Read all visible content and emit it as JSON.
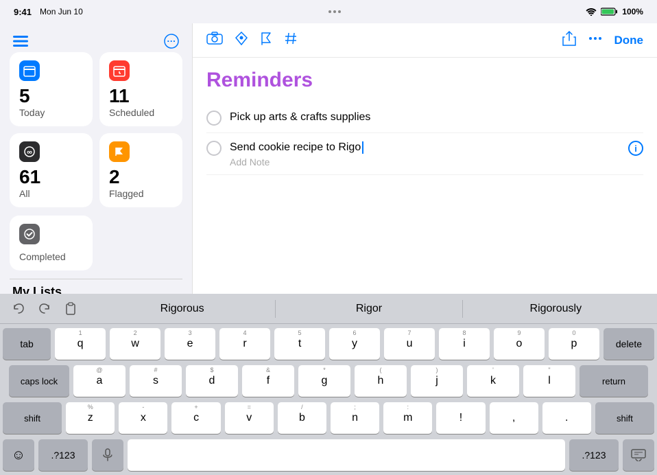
{
  "statusBar": {
    "time": "9:41",
    "date": "Mon Jun 10",
    "wifi": "WiFi",
    "battery": "100%"
  },
  "sidebar": {
    "smartLists": [
      {
        "id": "today",
        "label": "Today",
        "count": "5",
        "iconBg": "#007AFF",
        "iconSymbol": "📅"
      },
      {
        "id": "scheduled",
        "label": "Scheduled",
        "count": "11",
        "iconBg": "#FF3B30",
        "iconSymbol": "📅"
      },
      {
        "id": "all",
        "label": "All",
        "count": "61",
        "iconBg": "#2C2C2E",
        "iconSymbol": "∞"
      },
      {
        "id": "flagged",
        "label": "Flagged",
        "count": "2",
        "iconBg": "#FF9500",
        "iconSymbol": "⚑"
      }
    ],
    "completedLabel": "Completed",
    "myListsLabel": "My Lists"
  },
  "toolbar": {
    "doneLabel": "Done",
    "moreLabel": "...",
    "shareLabel": "Share"
  },
  "reminders": {
    "title": "Reminders",
    "items": [
      {
        "id": 1,
        "text": "Pick up arts & crafts supplies",
        "note": null
      },
      {
        "id": 2,
        "text": "Send cookie recipe to Rigo",
        "note": "Add Note",
        "active": true
      }
    ]
  },
  "autocomplete": {
    "actions": [
      "undo",
      "redo",
      "paste"
    ],
    "suggestions": [
      "Rigorous",
      "Rigor",
      "Rigorously"
    ]
  },
  "keyboard": {
    "row1": [
      {
        "key": "q",
        "num": "1"
      },
      {
        "key": "w",
        "num": "2"
      },
      {
        "key": "e",
        "num": "3"
      },
      {
        "key": "r",
        "num": "4"
      },
      {
        "key": "t",
        "num": "5"
      },
      {
        "key": "y",
        "num": "6"
      },
      {
        "key": "u",
        "num": "7"
      },
      {
        "key": "i",
        "num": "8"
      },
      {
        "key": "o",
        "num": "9"
      },
      {
        "key": "p",
        "num": "0"
      }
    ],
    "row2": [
      {
        "key": "a",
        "num": "@"
      },
      {
        "key": "s",
        "num": "#"
      },
      {
        "key": "d",
        "num": "$"
      },
      {
        "key": "f",
        "num": "&"
      },
      {
        "key": "g",
        "num": "*"
      },
      {
        "key": "h",
        "num": "("
      },
      {
        "key": "j",
        "num": ")"
      },
      {
        "key": "k",
        "num": "'"
      },
      {
        "key": "l",
        "num": "\""
      }
    ],
    "row3": [
      {
        "key": "z",
        "num": "%"
      },
      {
        "key": "x",
        "num": "-"
      },
      {
        "key": "c",
        "num": "+"
      },
      {
        "key": "v",
        "num": "="
      },
      {
        "key": "b",
        "num": "/"
      },
      {
        "key": "n",
        "num": ";"
      },
      {
        "key": "m",
        "num": ":"
      },
      {
        "key": "!",
        "num": ""
      },
      {
        "key": ",",
        "num": ""
      },
      {
        "key": ".",
        "num": ""
      }
    ],
    "spaceLabel": "",
    "tabLabel": "tab",
    "deleteLabel": "delete",
    "capsLockLabel": "caps lock",
    "returnLabel": "return",
    "shiftLabel": "shift",
    "emojiLabel": "☺",
    "numbersLabel": ".?123",
    "hideLabel": "⌨"
  }
}
